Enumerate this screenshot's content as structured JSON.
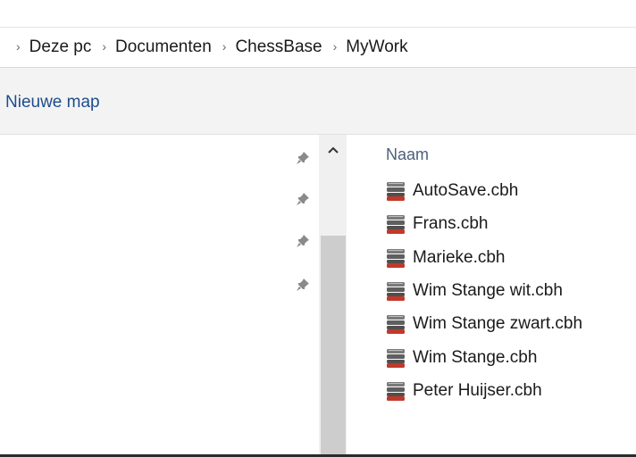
{
  "breadcrumb": {
    "items": [
      "Deze pc",
      "Documenten",
      "ChessBase",
      "MyWork"
    ],
    "separator": "›"
  },
  "toolbar": {
    "new_folder_label": "Nieuwe map"
  },
  "nav_pane": {
    "pin_icon": "pin-icon",
    "pin_glyph": "📌"
  },
  "file_list": {
    "column_header": "Naam",
    "files": [
      "AutoSave.cbh",
      "Frans.cbh",
      "Marieke.cbh",
      "Wim Stange wit.cbh",
      "Wim Stange zwart.cbh",
      "Wim Stange.cbh",
      "Peter Huijser.cbh"
    ],
    "file_icon": "chessbase-database-icon"
  },
  "colors": {
    "link_blue": "#1e4d8c",
    "header_text": "#4c607a",
    "toolbar_bg": "#f3f3f3",
    "scroll_thumb": "#cdcdcd"
  }
}
